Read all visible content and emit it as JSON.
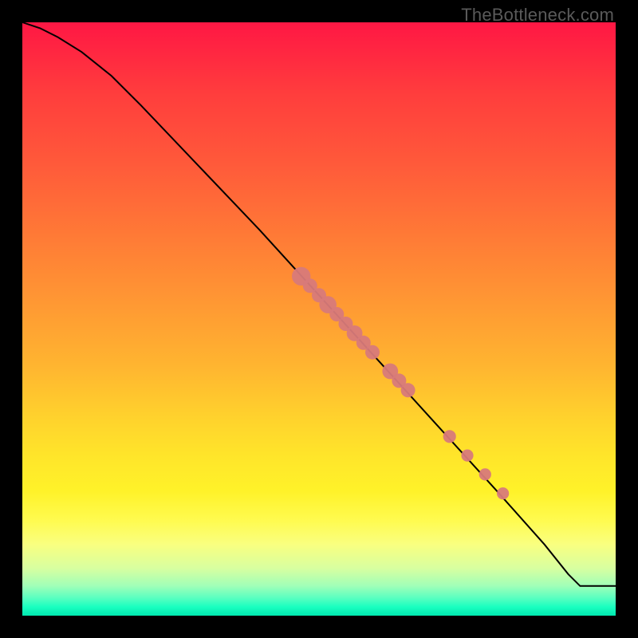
{
  "watermark": "TheBottleneck.com",
  "colors": {
    "background": "#000000",
    "marker": "#d87a7a",
    "curve": "#000000",
    "gradient_top": "#ff1744",
    "gradient_bottom": "#00e8b0"
  },
  "chart_data": {
    "type": "line",
    "title": "",
    "xlabel": "",
    "ylabel": "",
    "xlim": [
      0,
      100
    ],
    "ylim": [
      0,
      100
    ],
    "curve": {
      "x": [
        0,
        3,
        6,
        10,
        15,
        20,
        30,
        40,
        50,
        60,
        70,
        80,
        88,
        92,
        94,
        100
      ],
      "y": [
        100,
        99,
        97.5,
        95,
        91,
        86,
        75.5,
        65,
        54,
        43,
        32,
        21,
        12,
        7,
        5,
        5
      ]
    },
    "markers": {
      "name": "highlighted points",
      "x": [
        47,
        48.5,
        50,
        51.5,
        53,
        54.5,
        56,
        57.5,
        59,
        62,
        63.5,
        65,
        72,
        75,
        78,
        81
      ],
      "y": [
        57.2,
        55.6,
        54,
        52.4,
        50.8,
        49.2,
        47.6,
        46,
        44.4,
        41.2,
        39.6,
        38,
        30.2,
        27,
        23.8,
        20.6
      ],
      "radius_scale": [
        1.3,
        1.0,
        1.0,
        1.2,
        1.0,
        1.0,
        1.1,
        1.0,
        1.0,
        1.1,
        1.0,
        1.0,
        0.9,
        0.85,
        0.85,
        0.85
      ]
    }
  }
}
